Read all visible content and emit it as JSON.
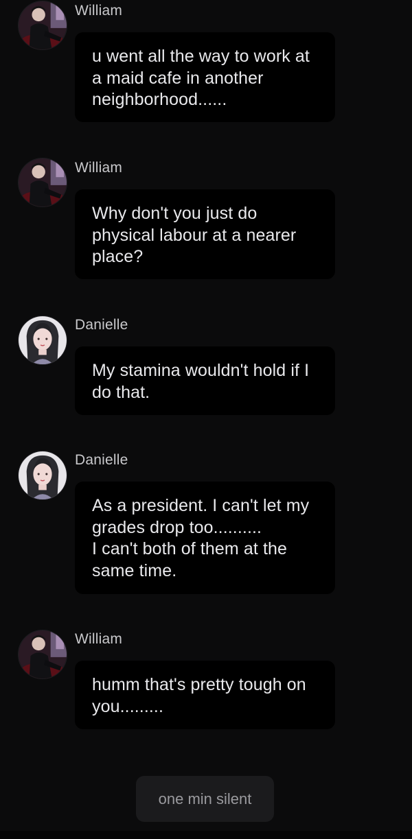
{
  "messages": [
    {
      "sender": "William",
      "avatar": "william-avatar",
      "text": "u went all the way to work at a maid cafe in another neighborhood......"
    },
    {
      "sender": "William",
      "avatar": "william-avatar",
      "text": "Why don't you just do physical labour at a nearer place?"
    },
    {
      "sender": "Danielle",
      "avatar": "danielle-avatar",
      "text": "My stamina wouldn't hold if I do that."
    },
    {
      "sender": "Danielle",
      "avatar": "danielle-avatar",
      "text": "As a president. I can't let my grades drop too..........\nI can't both of them at the same time."
    },
    {
      "sender": "William",
      "avatar": "william-avatar",
      "text": "humm that's pretty tough on you........."
    }
  ],
  "actions": {
    "silent_label": "one min silent"
  },
  "colors": {
    "background": "#0b0b0c",
    "bubble": "#000000",
    "text": "#e9e9ec",
    "name": "#c9c9cc"
  }
}
